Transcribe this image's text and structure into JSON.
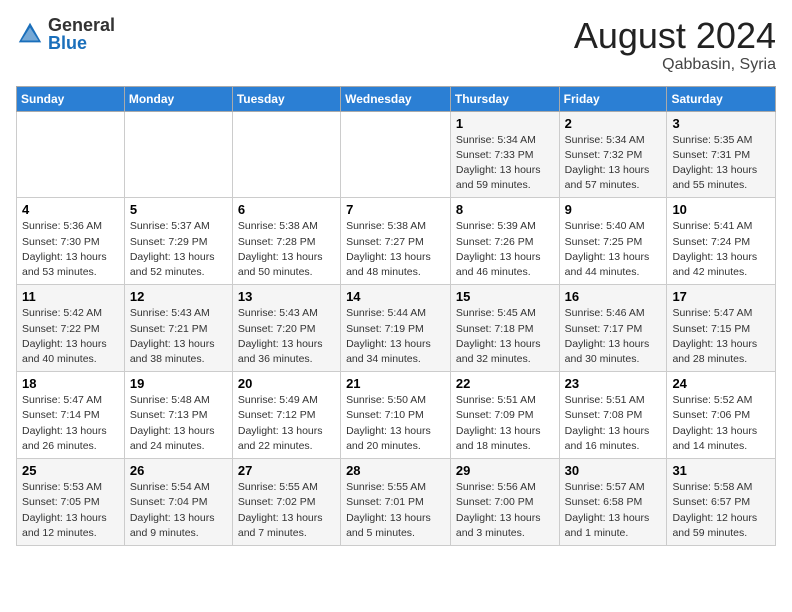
{
  "header": {
    "logo_general": "General",
    "logo_blue": "Blue",
    "month_year": "August 2024",
    "location": "Qabbasin, Syria"
  },
  "weekdays": [
    "Sunday",
    "Monday",
    "Tuesday",
    "Wednesday",
    "Thursday",
    "Friday",
    "Saturday"
  ],
  "weeks": [
    [
      {
        "day": "",
        "info": ""
      },
      {
        "day": "",
        "info": ""
      },
      {
        "day": "",
        "info": ""
      },
      {
        "day": "",
        "info": ""
      },
      {
        "day": "1",
        "info": "Sunrise: 5:34 AM\nSunset: 7:33 PM\nDaylight: 13 hours\nand 59 minutes."
      },
      {
        "day": "2",
        "info": "Sunrise: 5:34 AM\nSunset: 7:32 PM\nDaylight: 13 hours\nand 57 minutes."
      },
      {
        "day": "3",
        "info": "Sunrise: 5:35 AM\nSunset: 7:31 PM\nDaylight: 13 hours\nand 55 minutes."
      }
    ],
    [
      {
        "day": "4",
        "info": "Sunrise: 5:36 AM\nSunset: 7:30 PM\nDaylight: 13 hours\nand 53 minutes."
      },
      {
        "day": "5",
        "info": "Sunrise: 5:37 AM\nSunset: 7:29 PM\nDaylight: 13 hours\nand 52 minutes."
      },
      {
        "day": "6",
        "info": "Sunrise: 5:38 AM\nSunset: 7:28 PM\nDaylight: 13 hours\nand 50 minutes."
      },
      {
        "day": "7",
        "info": "Sunrise: 5:38 AM\nSunset: 7:27 PM\nDaylight: 13 hours\nand 48 minutes."
      },
      {
        "day": "8",
        "info": "Sunrise: 5:39 AM\nSunset: 7:26 PM\nDaylight: 13 hours\nand 46 minutes."
      },
      {
        "day": "9",
        "info": "Sunrise: 5:40 AM\nSunset: 7:25 PM\nDaylight: 13 hours\nand 44 minutes."
      },
      {
        "day": "10",
        "info": "Sunrise: 5:41 AM\nSunset: 7:24 PM\nDaylight: 13 hours\nand 42 minutes."
      }
    ],
    [
      {
        "day": "11",
        "info": "Sunrise: 5:42 AM\nSunset: 7:22 PM\nDaylight: 13 hours\nand 40 minutes."
      },
      {
        "day": "12",
        "info": "Sunrise: 5:43 AM\nSunset: 7:21 PM\nDaylight: 13 hours\nand 38 minutes."
      },
      {
        "day": "13",
        "info": "Sunrise: 5:43 AM\nSunset: 7:20 PM\nDaylight: 13 hours\nand 36 minutes."
      },
      {
        "day": "14",
        "info": "Sunrise: 5:44 AM\nSunset: 7:19 PM\nDaylight: 13 hours\nand 34 minutes."
      },
      {
        "day": "15",
        "info": "Sunrise: 5:45 AM\nSunset: 7:18 PM\nDaylight: 13 hours\nand 32 minutes."
      },
      {
        "day": "16",
        "info": "Sunrise: 5:46 AM\nSunset: 7:17 PM\nDaylight: 13 hours\nand 30 minutes."
      },
      {
        "day": "17",
        "info": "Sunrise: 5:47 AM\nSunset: 7:15 PM\nDaylight: 13 hours\nand 28 minutes."
      }
    ],
    [
      {
        "day": "18",
        "info": "Sunrise: 5:47 AM\nSunset: 7:14 PM\nDaylight: 13 hours\nand 26 minutes."
      },
      {
        "day": "19",
        "info": "Sunrise: 5:48 AM\nSunset: 7:13 PM\nDaylight: 13 hours\nand 24 minutes."
      },
      {
        "day": "20",
        "info": "Sunrise: 5:49 AM\nSunset: 7:12 PM\nDaylight: 13 hours\nand 22 minutes."
      },
      {
        "day": "21",
        "info": "Sunrise: 5:50 AM\nSunset: 7:10 PM\nDaylight: 13 hours\nand 20 minutes."
      },
      {
        "day": "22",
        "info": "Sunrise: 5:51 AM\nSunset: 7:09 PM\nDaylight: 13 hours\nand 18 minutes."
      },
      {
        "day": "23",
        "info": "Sunrise: 5:51 AM\nSunset: 7:08 PM\nDaylight: 13 hours\nand 16 minutes."
      },
      {
        "day": "24",
        "info": "Sunrise: 5:52 AM\nSunset: 7:06 PM\nDaylight: 13 hours\nand 14 minutes."
      }
    ],
    [
      {
        "day": "25",
        "info": "Sunrise: 5:53 AM\nSunset: 7:05 PM\nDaylight: 13 hours\nand 12 minutes."
      },
      {
        "day": "26",
        "info": "Sunrise: 5:54 AM\nSunset: 7:04 PM\nDaylight: 13 hours\nand 9 minutes."
      },
      {
        "day": "27",
        "info": "Sunrise: 5:55 AM\nSunset: 7:02 PM\nDaylight: 13 hours\nand 7 minutes."
      },
      {
        "day": "28",
        "info": "Sunrise: 5:55 AM\nSunset: 7:01 PM\nDaylight: 13 hours\nand 5 minutes."
      },
      {
        "day": "29",
        "info": "Sunrise: 5:56 AM\nSunset: 7:00 PM\nDaylight: 13 hours\nand 3 minutes."
      },
      {
        "day": "30",
        "info": "Sunrise: 5:57 AM\nSunset: 6:58 PM\nDaylight: 13 hours\nand 1 minute."
      },
      {
        "day": "31",
        "info": "Sunrise: 5:58 AM\nSunset: 6:57 PM\nDaylight: 12 hours\nand 59 minutes."
      }
    ]
  ]
}
